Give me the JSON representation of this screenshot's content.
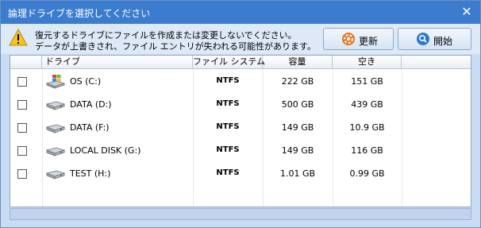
{
  "window": {
    "title": "論理ドライブを選択してください",
    "close_glyph": "✕"
  },
  "warning": {
    "line1": "復元するドライブにファイルを作成または変更しないでください。",
    "line2": "データが上書きされ、ファイル エントリが失われる可能性があります。",
    "icon": "warning-icon"
  },
  "toolbar": {
    "refresh_label": "更新",
    "refresh_icon": "gear-icon",
    "start_label": "開始",
    "start_icon": "search-icon"
  },
  "table": {
    "columns": [
      "ドライブ",
      "ファイル システム",
      "容量",
      "空き"
    ],
    "rows": [
      {
        "name": "OS (C:)",
        "fs": "NTFS",
        "capacity": "222 GB",
        "free": "151 GB",
        "icon": "system-drive-icon",
        "checked": false
      },
      {
        "name": "DATA (D:)",
        "fs": "NTFS",
        "capacity": "500 GB",
        "free": "439 GB",
        "icon": "hard-drive-icon",
        "checked": false
      },
      {
        "name": "DATA (F:)",
        "fs": "NTFS",
        "capacity": "149 GB",
        "free": "10.9 GB",
        "icon": "hard-drive-icon",
        "checked": false
      },
      {
        "name": "LOCAL DISK (G:)",
        "fs": "NTFS",
        "capacity": "149 GB",
        "free": "116 GB",
        "icon": "hard-drive-icon",
        "checked": false
      },
      {
        "name": "TEST (H:)",
        "fs": "NTFS",
        "capacity": "1.01 GB",
        "free": "0.99 GB",
        "icon": "hard-drive-icon",
        "checked": false
      }
    ]
  },
  "colors": {
    "titlebar": "#3b7ccf",
    "window_bg": "#c9dcf3",
    "toolbar_bg": "#dde9f7"
  }
}
